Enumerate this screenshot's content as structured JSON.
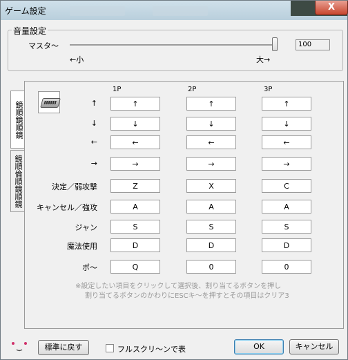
{
  "window": {
    "title": "ゲーム設定",
    "close_label": "X"
  },
  "volume": {
    "group_label": "音量設定",
    "master_label": "マスタ〜",
    "min_label": "←小",
    "max_label": "大→",
    "value": "100",
    "level_fraction": 1.0
  },
  "tabs": [
    {
      "label": "鏡順鏡順鏡"
    },
    {
      "label": "鏡順倫順鏡順鏡"
    }
  ],
  "key_config": {
    "columns": [
      "1P",
      "2P",
      "3P"
    ],
    "rows": [
      {
        "label": "↑",
        "keys": [
          "↑",
          "↑",
          "↑"
        ]
      },
      {
        "label": "↓",
        "keys": [
          "↓",
          "↓",
          "↓"
        ]
      },
      {
        "label": "←",
        "keys": [
          "←",
          "←",
          "←"
        ]
      },
      {
        "label": "→",
        "keys": [
          "→",
          "→",
          "→"
        ]
      },
      {
        "label": "決定／弱攻撃",
        "keys": [
          "Z",
          "X",
          "C"
        ]
      },
      {
        "label": "キャンセル／強攻",
        "keys": [
          "A",
          "A",
          "A"
        ]
      },
      {
        "label": "ジャン",
        "keys": [
          "S",
          "S",
          "S"
        ]
      },
      {
        "label": "魔法使用",
        "keys": [
          "D",
          "D",
          "D"
        ]
      },
      {
        "label": "ポ〜",
        "keys": [
          "Q",
          "0",
          "0"
        ]
      }
    ],
    "note_line1": "※設定したい項目をクリックして選択後、割り当てるボタンを押し",
    "note_line2": "割り当てるボタンのかわりにESCキ〜を押すとその項目はクリア3"
  },
  "footer": {
    "reset_label": "標準に戻す",
    "fullscreen_label": "フルスクリ〜ンで表",
    "fullscreen_checked": false,
    "ok_label": "OK",
    "cancel_label": "キャンセル"
  }
}
